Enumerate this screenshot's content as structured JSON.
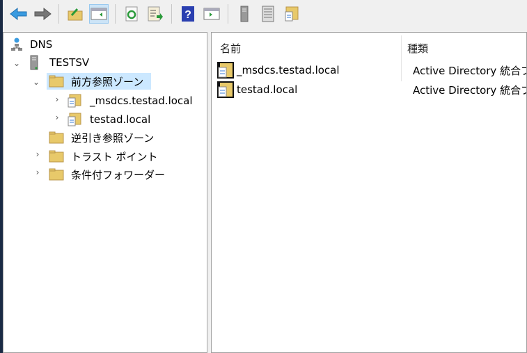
{
  "toolbar": {
    "buttons": [
      {
        "icon": "back-arrow-icon"
      },
      {
        "icon": "forward-arrow-icon"
      },
      {
        "icon": "up-folder-icon"
      },
      {
        "icon": "show-hide-console-tree-icon",
        "active": true
      },
      {
        "icon": "refresh-icon"
      },
      {
        "icon": "export-list-icon"
      },
      {
        "icon": "help-icon"
      },
      {
        "icon": "show-action-pane-icon"
      },
      {
        "icon": "server-icon"
      },
      {
        "icon": "records-list-icon"
      },
      {
        "icon": "zone-folder-icon"
      }
    ]
  },
  "tree": {
    "root": "DNS",
    "server": "TESTSV",
    "forward_zones": "前方参照ゾーン",
    "zones": [
      "_msdcs.testad.local",
      "testad.local"
    ],
    "reverse_zones": "逆引き参照ゾーン",
    "trust_points": "トラスト ポイント",
    "conditional_forwarders": "条件付フォワーダー"
  },
  "list": {
    "columns": [
      "名前",
      "種類"
    ],
    "rows": [
      {
        "name": "_msdcs.testad.local",
        "type": "Active Directory 統合プ"
      },
      {
        "name": "testad.local",
        "type": "Active Directory 統合プ"
      }
    ]
  },
  "colors": {
    "selection": "#cce8ff",
    "folder": "#e8c96a"
  }
}
